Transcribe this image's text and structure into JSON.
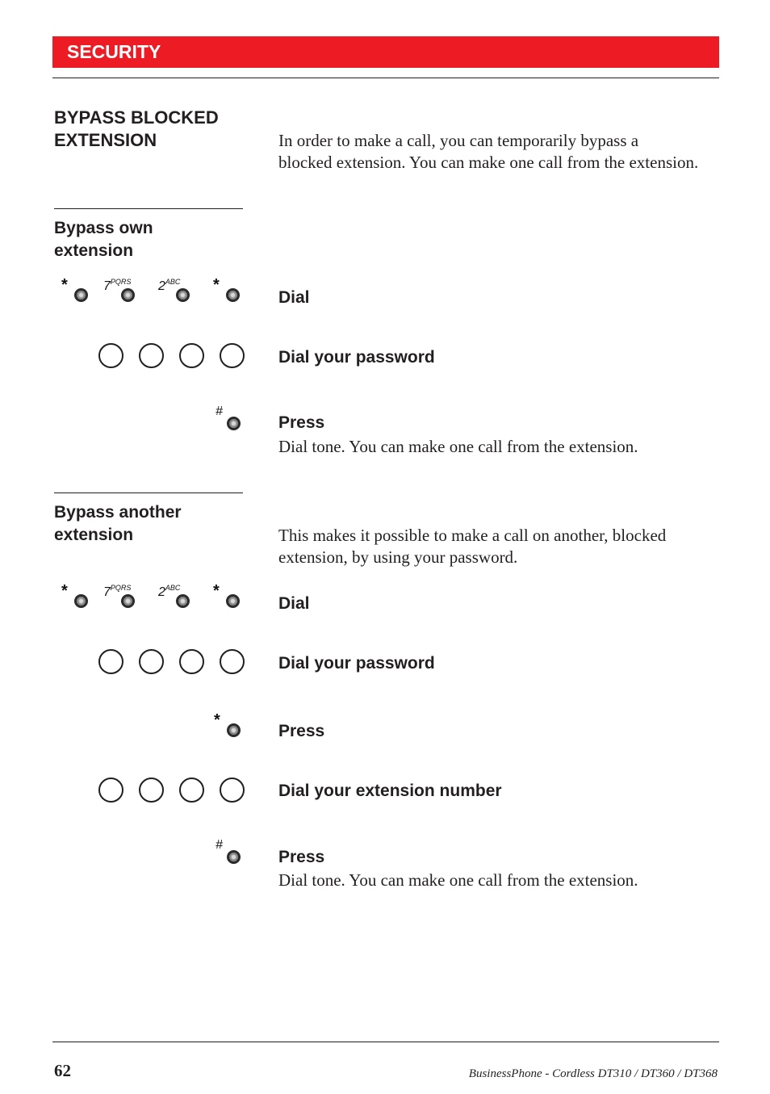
{
  "header": {
    "title": "SECURITY",
    "accent_color": "#ed1c24"
  },
  "section": {
    "title_line1": "BYPASS BLOCKED",
    "title_line2": "EXTENSION",
    "intro_line1": "In order to make a call, you can temporarily bypass a",
    "intro_line2": "blocked extension. You can make one call from the extension."
  },
  "own": {
    "title_line1": "Bypass own",
    "title_line2": "extension",
    "keys": [
      "*",
      "7",
      "PQRS",
      "2",
      "ABC",
      "*"
    ],
    "steps": {
      "dial": "Dial",
      "password": "Dial your password",
      "press": "Press",
      "press_note": "Dial tone. You can make one call from the extension."
    },
    "hash_key": "#"
  },
  "another": {
    "title_line1": "Bypass another",
    "title_line2": "extension",
    "intro_line1": "This makes it possible to make a call on another, blocked",
    "intro_line2": "extension, by using your password.",
    "steps": {
      "dial": "Dial",
      "password": "Dial your password",
      "press_star": "Press",
      "ext_number": "Dial your extension number",
      "press_hash": "Press",
      "press_note": "Dial tone. You can make one call from the extension."
    },
    "star_key": "*",
    "hash_key": "#"
  },
  "footer": {
    "page_number": "62",
    "product": "BusinessPhone - Cordless DT310 / DT360 / DT368"
  }
}
